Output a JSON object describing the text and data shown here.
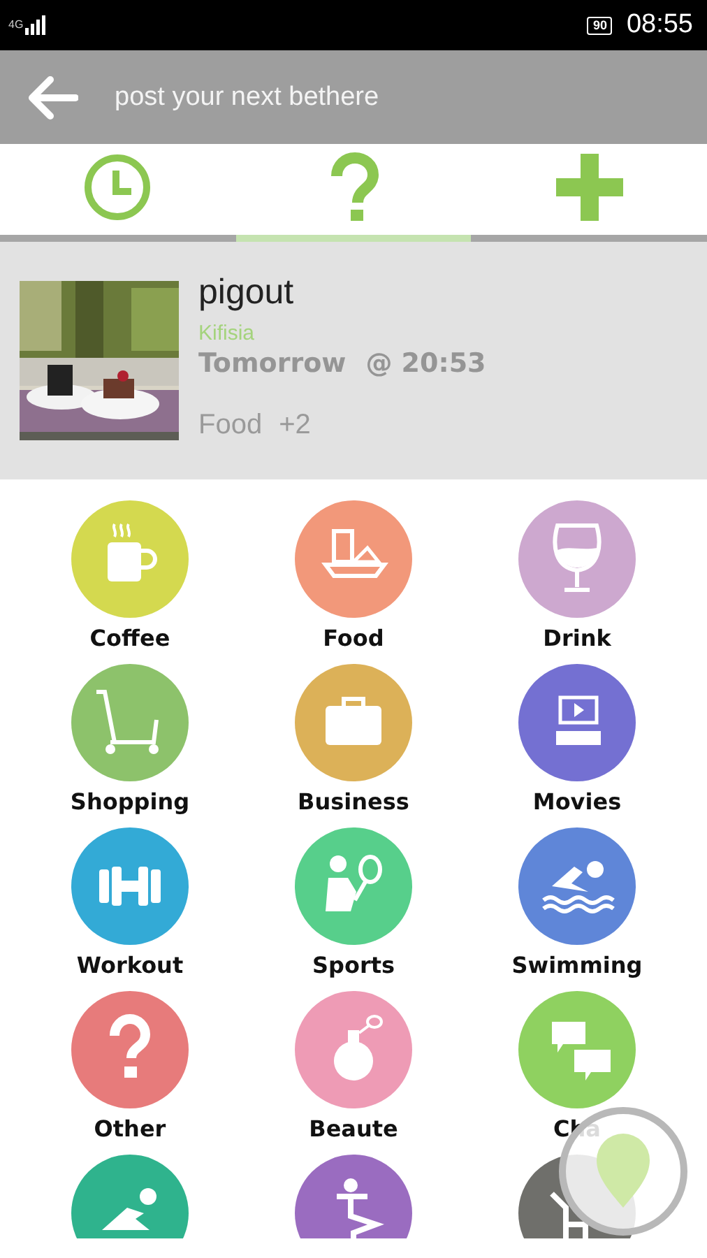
{
  "status_bar": {
    "network": "4G",
    "battery": "90",
    "time": "08:55"
  },
  "toolbar": {
    "title": "post your next bethere"
  },
  "tabs": [
    {
      "kind": "clock",
      "selected": false
    },
    {
      "kind": "question",
      "selected": true
    },
    {
      "kind": "plus",
      "selected": false
    }
  ],
  "event": {
    "title": "pigout",
    "location": "Kifisia",
    "day": "Tomorrow",
    "time": "@ 20:53",
    "category": "Food",
    "extra": "+2"
  },
  "categories": [
    {
      "label": "Coffee",
      "kind": "mug",
      "color": "#d4d94f"
    },
    {
      "label": "Food",
      "kind": "tray",
      "color": "#f2987a"
    },
    {
      "label": "Drink",
      "kind": "glass",
      "color": "#cda8cf"
    },
    {
      "label": "Shopping",
      "kind": "cart",
      "color": "#8dc26b"
    },
    {
      "label": "Business",
      "kind": "briefcase",
      "color": "#dcb158"
    },
    {
      "label": "Movies",
      "kind": "cinema",
      "color": "#7470d2"
    },
    {
      "label": "Workout",
      "kind": "dumbbell",
      "color": "#33aad6"
    },
    {
      "label": "Sports",
      "kind": "tennis",
      "color": "#57cf8b"
    },
    {
      "label": "Swimming",
      "kind": "swimmer",
      "color": "#5f86d8"
    },
    {
      "label": "Other",
      "kind": "question",
      "color": "#e77b7b"
    },
    {
      "label": "Beaute",
      "kind": "perfume",
      "color": "#ee9bb5"
    },
    {
      "label": "Cha",
      "kind": "chat",
      "color": "#8fd160"
    },
    {
      "kind": "lounging",
      "color": "#2fb38d"
    },
    {
      "kind": "dancer",
      "color": "#9a6cc0"
    },
    {
      "kind": "figure",
      "color": "#6f6f6b"
    }
  ],
  "map_button": {
    "kind": "pin"
  }
}
